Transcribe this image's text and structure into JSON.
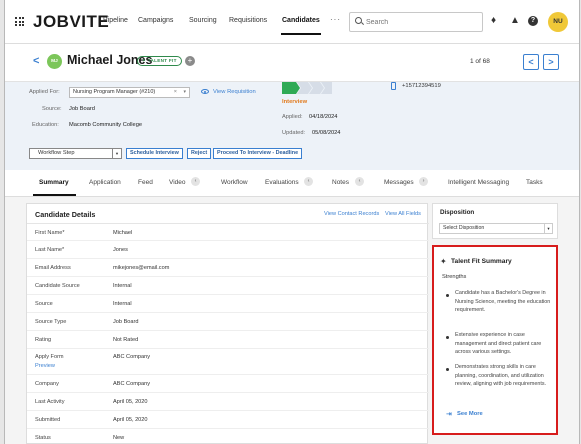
{
  "app": {
    "logo": "JOBVITE"
  },
  "nav": {
    "items": [
      "Pipeline",
      "Campaigns",
      "Sourcing",
      "Requisitions",
      "Candidates"
    ],
    "more": "···",
    "search_placeholder": "Search",
    "user_initials": "NU"
  },
  "candidate": {
    "initials": "MJ",
    "name": "Michael Jones",
    "badge": "TALENT FIT",
    "counter": "1 of 68"
  },
  "details": {
    "applied_for_label": "Applied For:",
    "applied_for_value": "Nursing Program Manager (#210)",
    "view_requisition": "View Requisition",
    "source_label": "Source:",
    "source_value": "Job Board",
    "education_label": "Education:",
    "education_value": "Macomb Community College",
    "stage_status": "Interview",
    "applied_label": "Applied:",
    "applied_value": "04/18/2024",
    "updated_label": "Updated:",
    "updated_value": "05/08/2024",
    "phone": "+15712394519",
    "workflow_step": "Workflow Step",
    "actions": [
      "Schedule Interview",
      "Reject",
      "Proceed To Interview - Deadline"
    ]
  },
  "tabs": [
    {
      "label": "Summary"
    },
    {
      "label": "Application"
    },
    {
      "label": "Feed"
    },
    {
      "label": "Video"
    },
    {
      "label": "Workflow"
    },
    {
      "label": "Evaluations"
    },
    {
      "label": "Notes"
    },
    {
      "label": "Messages"
    },
    {
      "label": "Intelligent Messaging"
    },
    {
      "label": "Tasks"
    }
  ],
  "card": {
    "title": "Candidate Details",
    "link_contact": "View Contact Records",
    "link_fields": "View All Fields",
    "rows": [
      {
        "label": "First Name*",
        "value": "Michael"
      },
      {
        "label": "Last Name*",
        "value": "Jones"
      },
      {
        "label": "Email Address",
        "value": "mikejones@email.com"
      },
      {
        "label": "Candidate Source",
        "value": "Internal"
      },
      {
        "label": "Source",
        "value": "Internal"
      },
      {
        "label": "Source Type",
        "value": "Job Board"
      },
      {
        "label": "Rating",
        "value": "Not Rated"
      },
      {
        "label": "Apply Form",
        "value": "ABC Company",
        "sublink": "Preview"
      },
      {
        "label": "Company",
        "value": "ABC Company"
      },
      {
        "label": "Last Activity",
        "value": "April 05, 2020"
      },
      {
        "label": "Submitted",
        "value": "April 05, 2020"
      },
      {
        "label": "Status",
        "value": "New"
      }
    ]
  },
  "disposition": {
    "title": "Disposition",
    "select": "Select Disposition"
  },
  "talent_fit": {
    "title": "Talent Fit Summary",
    "subtitle": "Strengths",
    "bullets": [
      "Candidate has a Bachelor's Degree in Nursing Science, meeting the education requirement.",
      "Extensive experience in case management and direct patient care across various settings.",
      "Demonstrates strong skills in care planning, coordination, and utilization review, aligning with job requirements."
    ],
    "see_more": "See More"
  },
  "colors": {
    "accent": "#3a7fd0",
    "stage_green": "#2faa55",
    "stage_orange": "#e17a1d",
    "highlight_red": "#d71c1c",
    "avatar_yellow": "#f0c838",
    "avatar_green": "#7cc65a"
  }
}
